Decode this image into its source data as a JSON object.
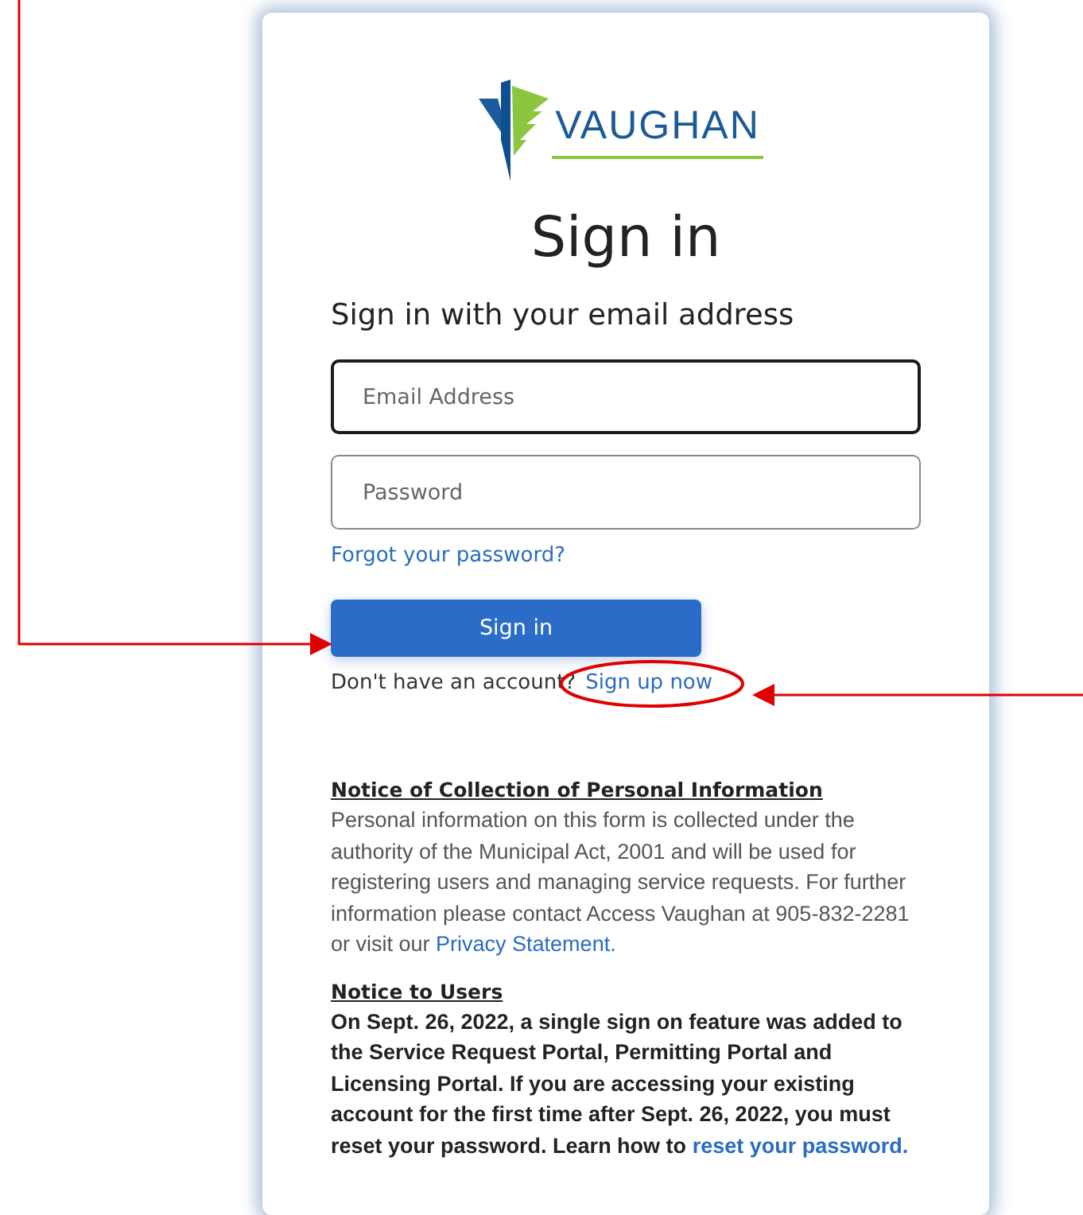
{
  "logo": {
    "text": "VAUGHAN"
  },
  "title": "Sign in",
  "subtitle": "Sign in with your email address",
  "fields": [
    {
      "placeholder": "Email Address",
      "focused": true
    },
    {
      "placeholder": "Password",
      "focused": false
    }
  ],
  "forgot_link": "Forgot your password?",
  "sign_in_button": "Sign in",
  "signup": {
    "text": "Don't have an account?",
    "link": "Sign up now"
  },
  "notices": [
    {
      "heading": "Notice of Collection of Personal Information",
      "kind": "plain",
      "text": "Personal information on this form is collected under the authority of the Municipal Act, 2001 and will be used for registering users and managing service requests. For further information please contact Access Vaughan at 905-832-2281 or visit our ",
      "link": "Privacy Statement."
    },
    {
      "heading": "Notice to Users",
      "kind": "bold",
      "text": "On Sept. 26, 2022, a single sign on feature was added to the Service Request Portal, Permitting Portal and Licensing Portal. If you are accessing your existing account for the first time after Sept. 26, 2022, you must reset your password. Learn how to ",
      "link": "reset your password."
    }
  ]
}
